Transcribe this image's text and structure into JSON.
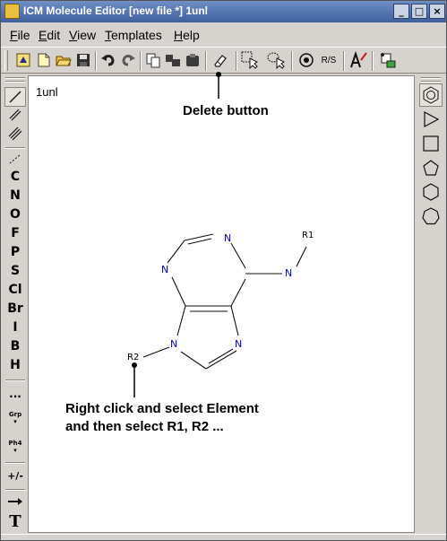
{
  "window": {
    "title": "ICM Molecule Editor [new file *] 1unl",
    "controls": {
      "minimize": "_",
      "maximize": "□",
      "close": "×"
    }
  },
  "menu": {
    "file": {
      "mnemonic": "F",
      "rest": "ile"
    },
    "edit": {
      "mnemonic": "E",
      "rest": "dit"
    },
    "view": {
      "mnemonic": "V",
      "rest": "iew"
    },
    "templates": {
      "mnemonic": "T",
      "rest": "emplates"
    },
    "help": {
      "mnemonic": "H",
      "rest": "elp"
    }
  },
  "toolbar": {
    "icons": [
      "new-molecule-icon",
      "new-file-icon",
      "open-folder-icon",
      "save-icon",
      "undo-icon",
      "redo-icon",
      "copy-icon",
      "cut-icon",
      "paste-icon",
      "eraser-icon",
      "select-box-icon",
      "lasso-select-icon",
      "stereo-center-icon",
      "atom-label-icon",
      "3d-icon"
    ],
    "rs_label": "R/S"
  },
  "palette": {
    "elements": [
      "C",
      "N",
      "O",
      "F",
      "P",
      "S",
      "Cl",
      "Br",
      "I",
      "B",
      "H"
    ],
    "more_label": "...",
    "group_label": "Grp",
    "ph4_label": "Ph4",
    "charge_label": "+/-",
    "text_tool_label": "T"
  },
  "canvas": {
    "molecule_name": "1unl",
    "atoms": {
      "n1": "N",
      "n3": "N",
      "n6": "N",
      "n7": "N",
      "n9": "N",
      "r1": "R1",
      "r2": "R2"
    }
  },
  "annotations": {
    "delete": "Delete button",
    "right_click_line1": "Right click and select Element",
    "right_click_line2": "and then select R1, R2 ..."
  },
  "colors": {
    "titlebar_start": "#6f8fc6",
    "titlebar_end": "#3f5f9f",
    "chrome": "#d6d3ce",
    "nitrogen": "#0000cc"
  }
}
